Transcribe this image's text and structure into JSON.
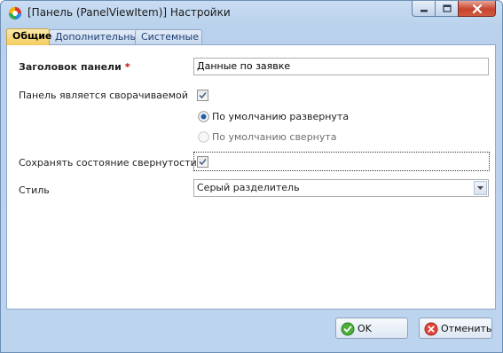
{
  "window": {
    "title": "[Панель (PanelViewItem)] Настройки",
    "icon": "app-logo-icon",
    "controls": [
      "minimize-icon",
      "maximize-icon",
      "close-icon"
    ]
  },
  "tabs": [
    {
      "label": "Общие",
      "active": true
    },
    {
      "label": "Дополнительные",
      "active": false
    },
    {
      "label": "Системные",
      "active": false
    }
  ],
  "form": {
    "panel_title_label": "Заголовок панели",
    "required_mark": "*",
    "panel_title_value": "Данные по заявке",
    "collapsible_label": "Панель является сворачиваемой",
    "collapsible_checked": true,
    "radio_expanded": "По умолчанию развернута",
    "radio_expanded_selected": true,
    "radio_collapsed": "По умолчанию свернута",
    "radio_collapsed_enabled": false,
    "save_state_label": "Сохранять состояние свернутости",
    "save_state_checked": true,
    "style_label": "Стиль",
    "style_value": "Серый разделитель"
  },
  "buttons": {
    "ok": "OK",
    "cancel": "Отменить"
  },
  "colors": {
    "accent_tab": "#f3cc5f",
    "frame": "#bcd4ee",
    "required": "#d40000"
  }
}
